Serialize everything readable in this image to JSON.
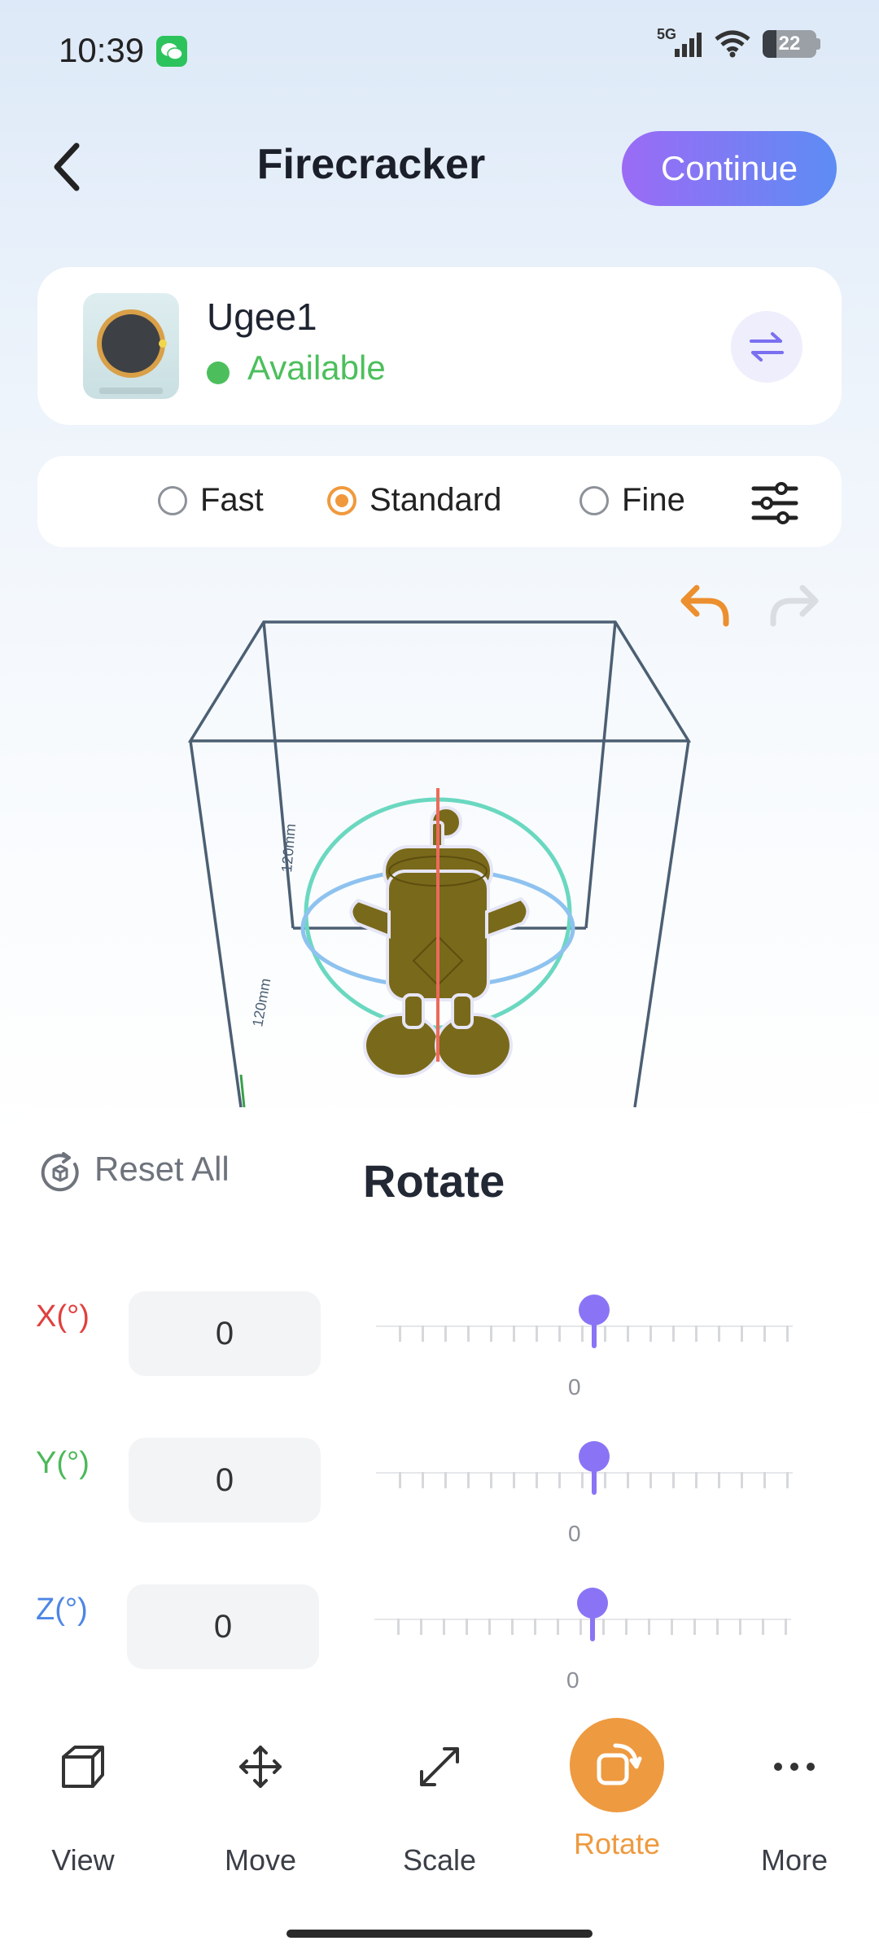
{
  "status_bar": {
    "time": "10:39",
    "network": "5G",
    "battery": "22"
  },
  "header": {
    "title": "Firecracker",
    "continue_label": "Continue"
  },
  "printer": {
    "name": "Ugee1",
    "status": "Available"
  },
  "quality": {
    "options": [
      {
        "label": "Fast",
        "selected": false
      },
      {
        "label": "Standard",
        "selected": true
      },
      {
        "label": "Fine",
        "selected": false
      }
    ]
  },
  "scene": {
    "dim_label_1": "120mm",
    "dim_label_2": "120mm"
  },
  "panel": {
    "reset_label": "Reset All",
    "title": "Rotate",
    "axes": [
      {
        "label": "X(°)",
        "value": "0",
        "color": "#e0403e"
      },
      {
        "label": "Y(°)",
        "value": "0",
        "color": "#4cb85a"
      },
      {
        "label": "Z(°)",
        "value": "0",
        "color": "#4d86e6"
      }
    ]
  },
  "nav": {
    "items": [
      {
        "label": "View",
        "icon": "cube-icon"
      },
      {
        "label": "Move",
        "icon": "move-arrows-icon"
      },
      {
        "label": "Scale",
        "icon": "scale-arrows-icon"
      },
      {
        "label": "Rotate",
        "icon": "rotate-icon",
        "active": true
      },
      {
        "label": "More",
        "icon": "more-dots-icon"
      }
    ]
  },
  "colors": {
    "accent": "#ee9a40",
    "brand_gradient_start": "#9b6bf5",
    "brand_gradient_end": "#5d8cf4",
    "slider": "#8a74f5"
  }
}
